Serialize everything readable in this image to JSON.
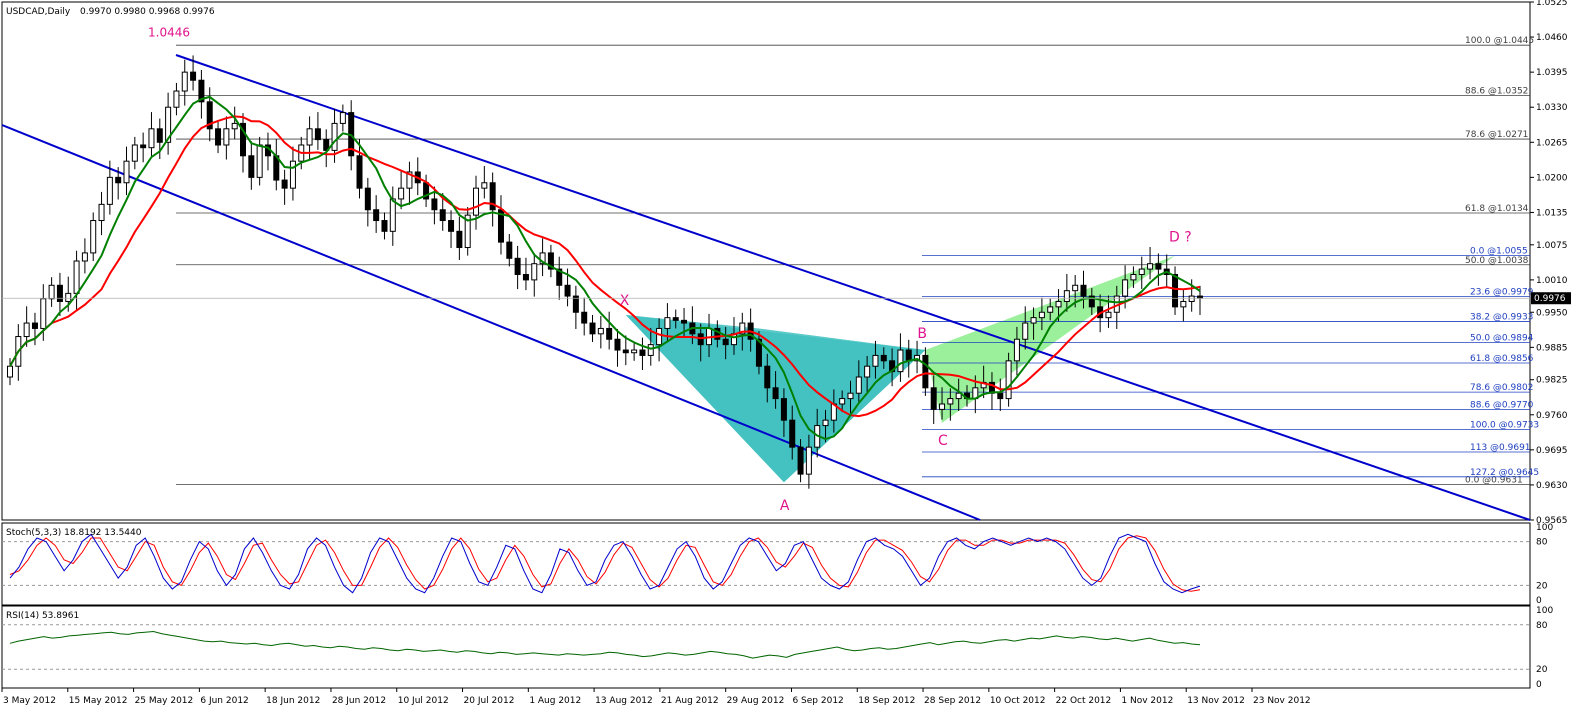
{
  "window": {
    "title": "USDCAD,Daily",
    "ohlc": "0.9970 0.9980 0.9968 0.9976"
  },
  "colors": {
    "background": "#ffffff",
    "bull_candle": "#ffffff",
    "bear_candle": "#000000",
    "ma_fast": "#008000",
    "ma_slow": "#ff0000",
    "channel": "#0000cc",
    "pattern_1": "#40c0c0",
    "pattern_2": "#90ee90",
    "pattern_label": "#e0148c",
    "fib_upper": "#404040",
    "fib_lower": "#2040c0",
    "current_price_bg": "#000000"
  },
  "chart_data": [
    {
      "type": "candlestick",
      "name": "main",
      "symbol": "USDCAD",
      "timeframe": "Daily",
      "ylim": [
        0.9565,
        1.0525
      ],
      "y_ticks": [
        "1.0525",
        "1.0460",
        "1.0395",
        "1.0330",
        "1.0265",
        "1.0200",
        "1.0135",
        "1.0075",
        "1.0010",
        "0.9950",
        "0.9885",
        "0.9825",
        "0.9760",
        "0.9695",
        "0.9630",
        "0.9565"
      ],
      "current_price": "0.9976",
      "x_ticks": [
        "3 May 2012",
        "15 May 2012",
        "25 May 2012",
        "6 Jun 2012",
        "18 Jun 2012",
        "28 Jun 2012",
        "10 Jul 2012",
        "20 Jul 2012",
        "1 Aug 2012",
        "13 Aug 2012",
        "21 Aug 2012",
        "29 Aug 2012",
        "6 Sep 2012",
        "18 Sep 2012",
        "28 Sep 2012",
        "10 Oct 2012",
        "22 Oct 2012",
        "1 Nov 2012",
        "13 Nov 2012",
        "23 Nov 2012"
      ],
      "close_path": [
        0.985,
        0.9905,
        0.993,
        0.992,
        0.9975,
        1.0,
        0.997,
        0.9985,
        1.0045,
        1.006,
        1.012,
        1.015,
        1.02,
        1.019,
        1.023,
        1.026,
        1.0255,
        1.029,
        1.0265,
        1.033,
        1.036,
        1.0395,
        1.038,
        1.034,
        1.029,
        1.026,
        1.029,
        1.03,
        1.024,
        1.02,
        1.026,
        1.024,
        1.0195,
        1.018,
        1.023,
        1.026,
        1.029,
        1.027,
        1.025,
        1.03,
        1.032,
        1.024,
        1.018,
        1.014,
        1.012,
        1.01,
        1.016,
        1.018,
        1.021,
        1.019,
        1.016,
        1.014,
        1.012,
        1.01,
        1.007,
        1.013,
        1.018,
        1.019,
        1.014,
        1.008,
        1.005,
        1.002,
        1.001,
        1.004,
        1.006,
        1.003,
        1.0,
        0.998,
        0.995,
        0.993,
        0.991,
        0.992,
        0.99,
        0.988,
        0.9875,
        0.988,
        0.987,
        0.989,
        0.992,
        0.994,
        0.9935,
        0.993,
        0.991,
        0.989,
        0.992,
        0.99,
        0.989,
        0.991,
        0.993,
        0.99,
        0.985,
        0.981,
        0.979,
        0.975,
        0.97,
        0.965,
        0.97,
        0.974,
        0.975,
        0.978,
        0.979,
        0.98,
        0.983,
        0.985,
        0.987,
        0.986,
        0.984,
        0.988,
        0.986,
        0.987,
        0.981,
        0.977,
        0.978,
        0.979,
        0.98,
        0.979,
        0.981,
        0.982,
        0.98,
        0.979,
        0.986,
        0.99,
        0.993,
        0.994,
        0.995,
        0.996,
        0.997,
        0.999,
        1.0,
        0.998,
        0.996,
        0.994,
        0.995,
        0.998,
        1.001,
        1.002,
        1.003,
        1.004,
        1.003,
        1.002,
        0.996,
        0.997,
        0.998,
        0.9976
      ],
      "ma_fast_label": "",
      "ma_slow_label": "",
      "pattern_labels": [
        "X",
        "A",
        "B",
        "C",
        "D ?"
      ],
      "high_label": "1.0446",
      "fib_upper": [
        {
          "label": "100.0 @1.0445",
          "value": 1.0445
        },
        {
          "label": "88.6 @1.0352",
          "value": 1.0352
        },
        {
          "label": "78.6 @1.0271",
          "value": 1.0271
        },
        {
          "label": "61.8 @1.0134",
          "value": 1.0134
        },
        {
          "label": "50.0 @1.0038",
          "value": 1.0038
        },
        {
          "label": "0.0 @0.9631",
          "value": 0.9631
        }
      ],
      "fib_lower": [
        {
          "label": "0.0 @1.0055",
          "value": 1.0055
        },
        {
          "label": "23.6 @0.9979",
          "value": 0.9979
        },
        {
          "label": "38.2 @0.9933",
          "value": 0.9933
        },
        {
          "label": "50.0 @0.9894",
          "value": 0.9894
        },
        {
          "label": "61.8 @0.9856",
          "value": 0.9856
        },
        {
          "label": "78.6 @0.9802",
          "value": 0.9802
        },
        {
          "label": "88.6 @0.9770",
          "value": 0.977
        },
        {
          "label": "100.0 @0.9733",
          "value": 0.9733
        },
        {
          "label": "113 @0.9691",
          "value": 0.9691
        },
        {
          "label": "127.2 @0.9645",
          "value": 0.9645
        }
      ]
    },
    {
      "type": "line",
      "name": "stochastic",
      "label": "Stoch(5,3,3) 18.8192 13.5440",
      "ylim": [
        0,
        100
      ],
      "y_ticks": [
        "100",
        "80",
        "20",
        "0"
      ],
      "levels": [
        80,
        20
      ],
      "main": [
        30,
        45,
        70,
        85,
        80,
        60,
        40,
        55,
        80,
        90,
        70,
        50,
        30,
        45,
        75,
        85,
        60,
        30,
        15,
        25,
        55,
        80,
        70,
        40,
        20,
        35,
        70,
        85,
        65,
        40,
        20,
        15,
        35,
        70,
        85,
        75,
        45,
        20,
        10,
        30,
        65,
        85,
        80,
        55,
        30,
        15,
        10,
        30,
        60,
        85,
        80,
        50,
        25,
        20,
        45,
        75,
        70,
        40,
        15,
        10,
        35,
        70,
        65,
        40,
        20,
        25,
        55,
        75,
        80,
        60,
        35,
        15,
        20,
        45,
        70,
        80,
        60,
        30,
        15,
        25,
        50,
        75,
        85,
        80,
        60,
        40,
        50,
        75,
        80,
        55,
        30,
        20,
        15,
        25,
        55,
        80,
        85,
        75,
        70,
        60,
        40,
        20,
        30,
        60,
        80,
        85,
        75,
        70,
        80,
        85,
        80,
        75,
        80,
        85,
        80,
        85,
        80,
        70,
        50,
        30,
        20,
        30,
        60,
        85,
        90,
        85,
        80,
        50,
        25,
        15,
        10,
        15,
        19
      ],
      "signal": [
        35,
        40,
        55,
        75,
        85,
        75,
        55,
        50,
        65,
        85,
        85,
        65,
        45,
        40,
        60,
        80,
        75,
        45,
        25,
        20,
        40,
        65,
        78,
        60,
        35,
        28,
        50,
        75,
        78,
        55,
        35,
        22,
        25,
        50,
        75,
        82,
        65,
        40,
        20,
        20,
        45,
        72,
        85,
        72,
        48,
        28,
        15,
        20,
        42,
        70,
        85,
        70,
        42,
        25,
        30,
        55,
        75,
        60,
        35,
        18,
        22,
        50,
        70,
        55,
        32,
        22,
        38,
        62,
        78,
        72,
        50,
        28,
        18,
        30,
        55,
        75,
        72,
        48,
        25,
        20,
        35,
        60,
        80,
        85,
        72,
        52,
        45,
        60,
        78,
        72,
        48,
        30,
        20,
        18,
        38,
        65,
        82,
        82,
        75,
        68,
        52,
        32,
        25,
        42,
        68,
        82,
        82,
        75,
        75,
        82,
        82,
        78,
        78,
        82,
        82,
        82,
        82,
        78,
        62,
        42,
        28,
        25,
        42,
        70,
        85,
        88,
        85,
        68,
        42,
        22,
        14,
        12,
        14
      ]
    },
    {
      "type": "line",
      "name": "rsi",
      "label": "RSI(14) 53.8961",
      "ylim": [
        0,
        100
      ],
      "y_ticks": [
        "100",
        "80",
        "20",
        "0"
      ],
      "levels": [
        80,
        20
      ],
      "values": [
        55,
        58,
        60,
        62,
        64,
        62,
        63,
        65,
        66,
        67,
        68,
        69,
        70,
        68,
        67,
        69,
        70,
        71,
        68,
        66,
        64,
        62,
        60,
        58,
        57,
        58,
        56,
        55,
        54,
        55,
        53,
        52,
        54,
        55,
        53,
        51,
        52,
        50,
        49,
        51,
        50,
        48,
        47,
        49,
        48,
        46,
        45,
        47,
        46,
        44,
        45,
        46,
        44,
        43,
        45,
        44,
        42,
        41,
        43,
        42,
        40,
        41,
        42,
        41,
        40,
        39,
        41,
        40,
        39,
        40,
        41,
        43,
        42,
        40,
        39,
        37,
        38,
        40,
        42,
        41,
        39,
        40,
        42,
        44,
        43,
        41,
        40,
        38,
        35,
        37,
        39,
        38,
        36,
        40,
        42,
        44,
        46,
        48,
        50,
        47,
        45,
        46,
        48,
        49,
        47,
        48,
        50,
        52,
        54,
        56,
        53,
        55,
        57,
        58,
        56,
        55,
        57,
        59,
        60,
        58,
        60,
        62,
        61,
        63,
        65,
        63,
        62,
        64,
        63,
        61,
        60,
        62,
        60,
        58,
        60,
        62,
        59,
        57,
        55,
        56,
        54,
        53
      ]
    }
  ]
}
